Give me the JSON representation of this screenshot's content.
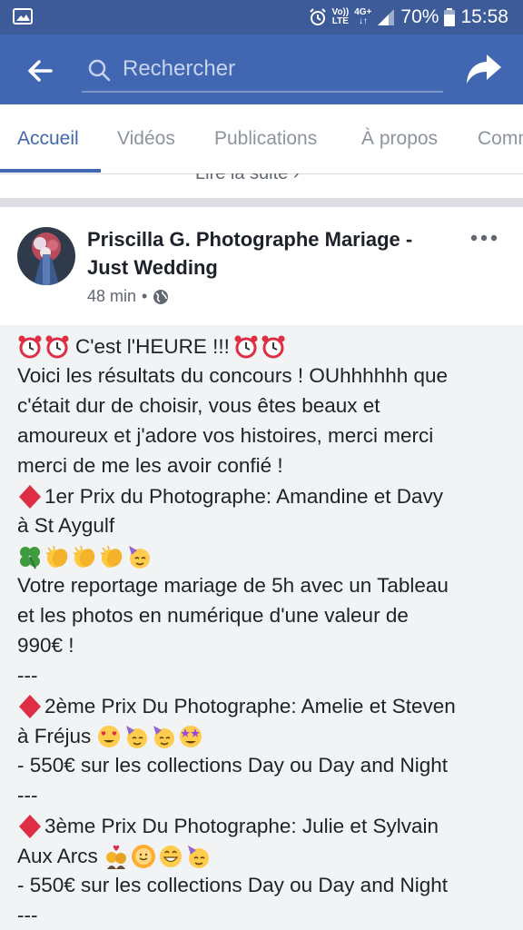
{
  "status_bar": {
    "network_top": "Vo))",
    "network_bottom": "LTE",
    "signal": "4G+",
    "battery_pct": "70%",
    "time": "15:58"
  },
  "app_bar": {
    "search_placeholder": "Rechercher"
  },
  "tabs": [
    "Accueil",
    "Vidéos",
    "Publications",
    "À propos",
    "Comm"
  ],
  "read_more": "Lire la suite",
  "post": {
    "author": "Priscilla G. Photographe Mariage - Just Wedding",
    "time": "48 min",
    "lines": [
      "C'est l'HEURE !!!",
      "Voici les résultats du concours ! OUhhhhhh que",
      "c'était dur de choisir, vous êtes beaux et",
      "amoureux et j'adore vos histoires, merci merci",
      "merci de me les avoir confié !",
      "1er Prix du Photographe: Amandine et Davy",
      "à St Aygulf",
      "Votre reportage mariage de 5h avec un Tableau",
      "et les photos en numérique d'une valeur de",
      "990€ !",
      "---",
      "2ème Prix Du Photographe: Amelie et Steven",
      "à Fréjus",
      "- 550€ sur les collections Day ou Day and Night",
      "---",
      "3ème Prix Du Photographe: Julie et Sylvain",
      "Aux Arcs",
      "- 550€ sur les collections Day ou Day and Night",
      "---"
    ]
  },
  "colors": {
    "status_bar": "#3d5a99",
    "app_bar": "#4267b2",
    "post_background": "#f2f3f5",
    "text": "#1d2129"
  }
}
